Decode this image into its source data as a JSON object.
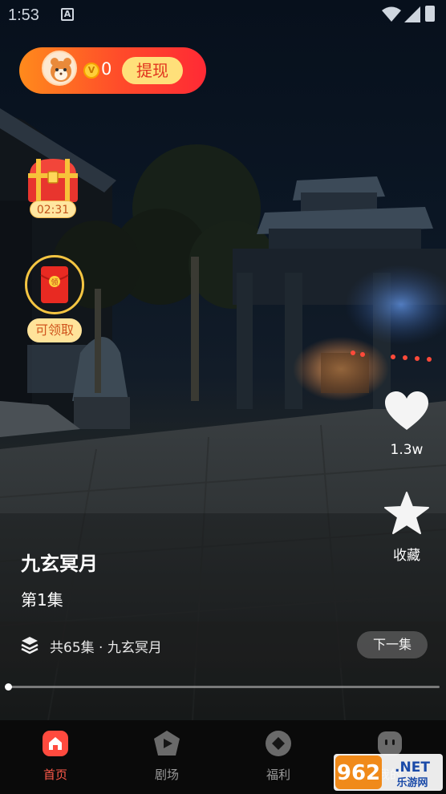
{
  "status_bar": {
    "time": "1:53",
    "icons": [
      "a-notification-icon",
      "wifi-icon",
      "signal-icon",
      "battery-icon"
    ]
  },
  "rewards": {
    "coin_count": "0",
    "withdraw_label": "提现",
    "chest_timer": "02:31",
    "red_packet_label": "可领取",
    "red_packet_glyph": "领"
  },
  "actions": {
    "like_count": "1.3w",
    "favorite_label": "收藏"
  },
  "drama": {
    "title": "九玄冥月",
    "episode": "第1集",
    "series_info": "共65集 · 九玄冥月",
    "next_label": "下一集"
  },
  "playback": {
    "progress_fraction": 0.0
  },
  "tabs": [
    {
      "label": "首页",
      "icon": "home-icon",
      "active": true
    },
    {
      "label": "剧场",
      "icon": "theater-icon",
      "active": false
    },
    {
      "label": "福利",
      "icon": "welfare-icon",
      "active": false
    },
    {
      "label": "我的",
      "icon": "profile-icon",
      "active": false
    }
  ],
  "watermark": {
    "text_main": "962.NET",
    "text_sub": "乐游网"
  },
  "colors": {
    "accent": "#ff5a4a",
    "pill_start": "#ff8a1c",
    "pill_end": "#ff2a35",
    "gold": "#ffe07a"
  }
}
